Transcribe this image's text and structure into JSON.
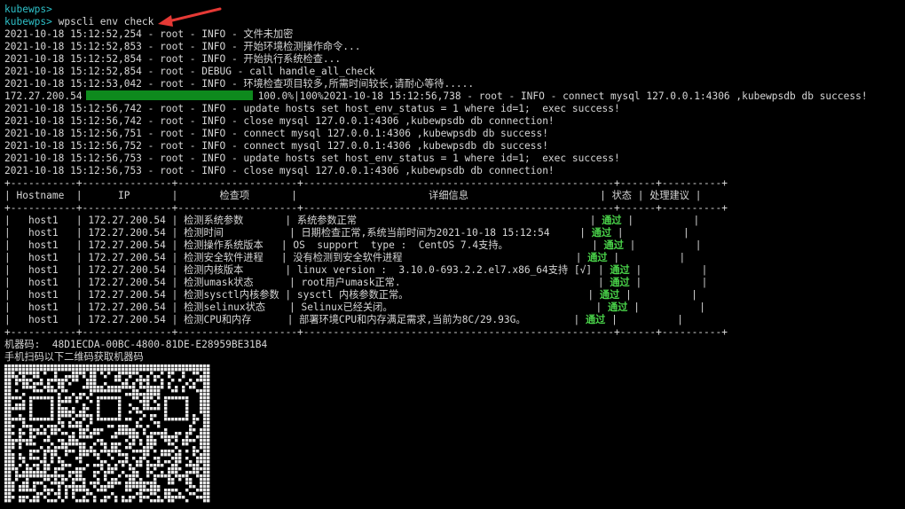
{
  "terminal": {
    "prompt_line": "kubewps>",
    "prompt": "kubewps>",
    "command": "wpscli env check",
    "log_pre": [
      "2021-10-18 15:12:52,254 - root - INFO - 文件未加密",
      "2021-10-18 15:12:52,853 - root - INFO - 开始环境检测操作命令...",
      "2021-10-18 15:12:52,854 - root - INFO - 开始执行系统检查...",
      "2021-10-18 15:12:52,854 - root - DEBUG - call handle_all_check",
      "2021-10-18 15:12:53,042 - root - INFO - 环境检查项目较多,所需时间较长,请耐心等待....."
    ],
    "progress": {
      "host": "172.27.200.54",
      "percent": 100,
      "text": "100.0%|100%2021-10-18 15:12:56,738 - root - INFO - connect mysql 127.0.0.1:4306 ,kubewpsdb db success!"
    },
    "log_post": [
      "2021-10-18 15:12:56,742 - root - INFO - update hosts set host_env_status = 1 where id=1;  exec success!",
      "2021-10-18 15:12:56,742 - root - INFO - close mysql 127.0.0.1:4306 ,kubewpsdb db connection!",
      "2021-10-18 15:12:56,751 - root - INFO - connect mysql 127.0.0.1:4306 ,kubewpsdb db success!",
      "2021-10-18 15:12:56,752 - root - INFO - connect mysql 127.0.0.1:4306 ,kubewpsdb db success!",
      "2021-10-18 15:12:56,753 - root - INFO - update hosts set host_env_status = 1 where id=1;  exec success!",
      "2021-10-18 15:12:56,753 - root - INFO - close mysql 127.0.0.1:4306 ,kubewpsdb db connection!"
    ],
    "table": {
      "headers": [
        "Hostname",
        "IP",
        "检查项",
        "详细信息",
        "状态",
        "处理建议"
      ],
      "rows": [
        [
          "host1",
          "172.27.200.54",
          "检测系统参数",
          "系统参数正常",
          "通过",
          ""
        ],
        [
          "host1",
          "172.27.200.54",
          "检测时间",
          "日期检查正常,系统当前时间为2021-10-18 15:12:54",
          "通过",
          ""
        ],
        [
          "host1",
          "172.27.200.54",
          "检测操作系统版本",
          "OS  support  type :  CentOS 7.4支持。",
          "通过",
          ""
        ],
        [
          "host1",
          "172.27.200.54",
          "检测安全软件进程",
          "没有检测到安全软件进程",
          "通过",
          ""
        ],
        [
          "host1",
          "172.27.200.54",
          "检测内核版本",
          "linux version :  3.10.0-693.2.2.el7.x86_64支持 [√]",
          "通过",
          ""
        ],
        [
          "host1",
          "172.27.200.54",
          "检测umask状态",
          "root用户umask正常.",
          "通过",
          ""
        ],
        [
          "host1",
          "172.27.200.54",
          "检测sysctl内核参数",
          "sysctl 内核参数正常。",
          "通过",
          ""
        ],
        [
          "host1",
          "172.27.200.54",
          "检测selinux状态",
          "Selinux已经关闭。",
          "通过",
          ""
        ],
        [
          "host1",
          "172.27.200.54",
          "检测CPU和内存",
          "部署环境CPU和内存满足需求,当前为8C/29.93G。",
          "通过",
          ""
        ]
      ]
    },
    "machine_code_line": "机器码:  48D1ECDA-00BC-4800-81DE-E28959BE31B4",
    "qr_hint": "手机扫码以下二维码获取机器码"
  },
  "colors": {
    "background": "#000000",
    "text": "#d6d6d6",
    "prompt": "#2ec0c8",
    "pass": "#4ad44a",
    "progress_bar": "#0e8a1d",
    "annotation_arrow": "#e53935"
  }
}
